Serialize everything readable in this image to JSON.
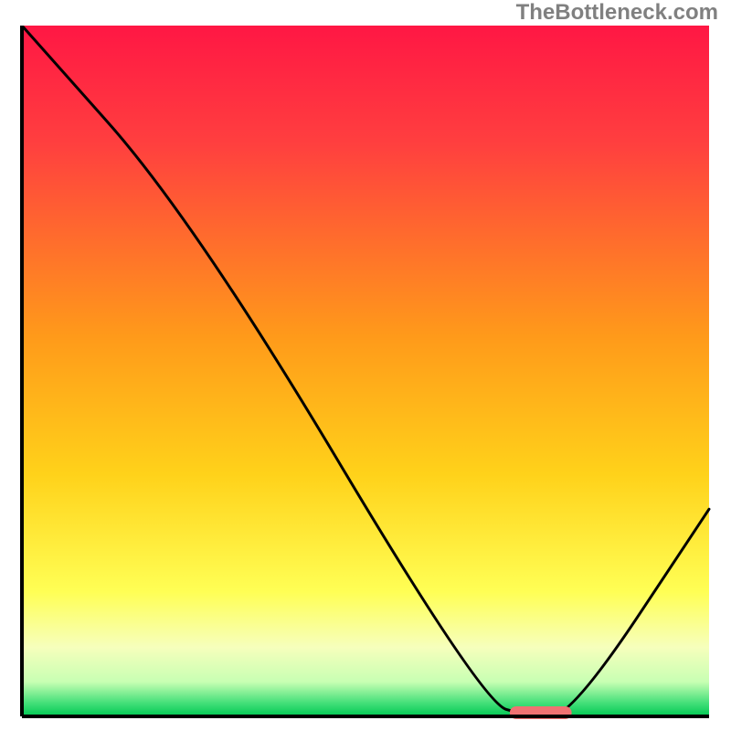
{
  "watermark": "TheBottleneck.com",
  "chart_data": {
    "type": "line",
    "title": "",
    "xlabel": "",
    "ylabel": "",
    "xlim": [
      0,
      100
    ],
    "ylim": [
      0,
      100
    ],
    "x": [
      0,
      25,
      67,
      74,
      80,
      100
    ],
    "values": [
      100,
      72,
      2,
      0,
      0,
      30
    ],
    "marker": {
      "x_start": 71,
      "x_end": 80,
      "y": 0,
      "color": "#ef7272"
    },
    "background_gradient": {
      "stops": [
        {
          "offset": 0.0,
          "color": "#ff1744"
        },
        {
          "offset": 0.17,
          "color": "#ff3f3f"
        },
        {
          "offset": 0.45,
          "color": "#ff9a1a"
        },
        {
          "offset": 0.65,
          "color": "#ffd21a"
        },
        {
          "offset": 0.82,
          "color": "#ffff55"
        },
        {
          "offset": 0.9,
          "color": "#f6ffbc"
        },
        {
          "offset": 0.95,
          "color": "#c8ffb3"
        },
        {
          "offset": 0.98,
          "color": "#46e07a"
        },
        {
          "offset": 1.0,
          "color": "#00c853"
        }
      ]
    }
  }
}
